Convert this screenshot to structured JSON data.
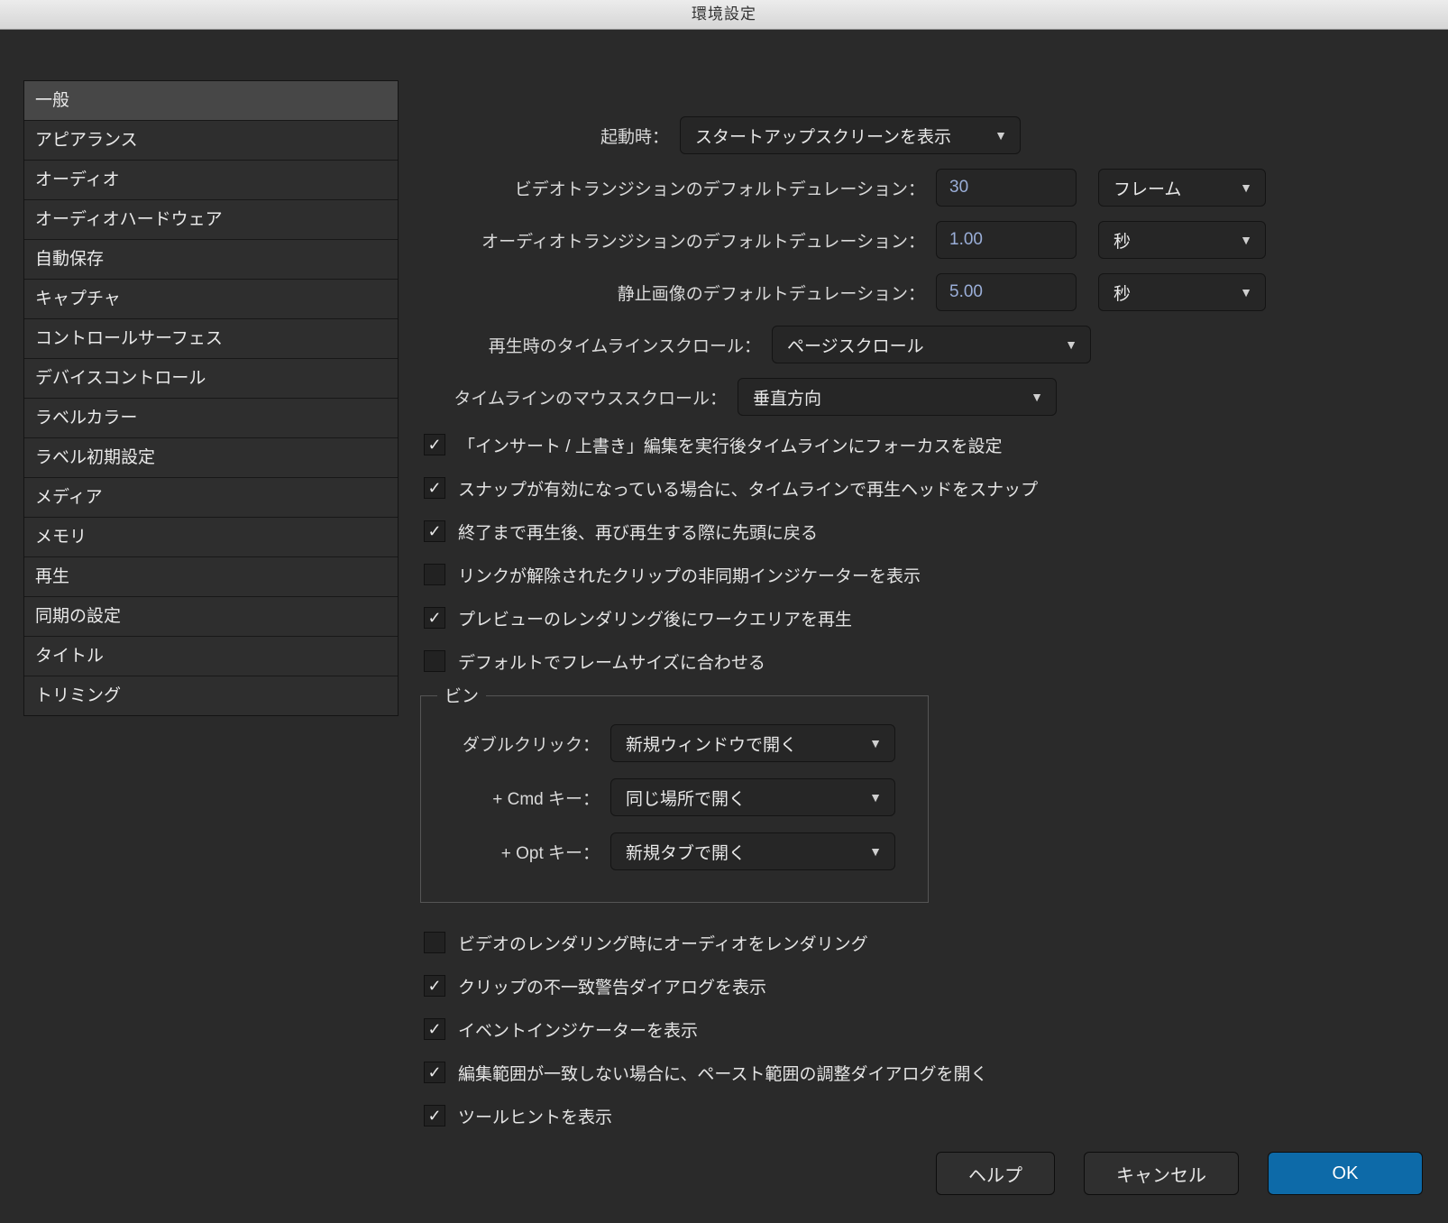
{
  "window_title": "環境設定",
  "sidebar": {
    "items": [
      "一般",
      "アピアランス",
      "オーディオ",
      "オーディオハードウェア",
      "自動保存",
      "キャプチャ",
      "コントロールサーフェス",
      "デバイスコントロール",
      "ラベルカラー",
      "ラベル初期設定",
      "メディア",
      "メモリ",
      "再生",
      "同期の設定",
      "タイトル",
      "トリミング"
    ],
    "selected_index": 0
  },
  "general": {
    "startup_label": "起動時：",
    "startup_value": "スタートアップスクリーンを表示",
    "video_trans_label": "ビデオトランジションのデフォルトデュレーション：",
    "video_trans_value": "30",
    "video_trans_unit": "フレーム",
    "audio_trans_label": "オーディオトランジションのデフォルトデュレーション：",
    "audio_trans_value": "1.00",
    "audio_trans_unit": "秒",
    "still_label": "静止画像のデフォルトデュレーション：",
    "still_value": "5.00",
    "still_unit": "秒",
    "playback_scroll_label": "再生時のタイムラインスクロール：",
    "playback_scroll_value": "ページスクロール",
    "mouse_scroll_label": "タイムラインのマウススクロール：",
    "mouse_scroll_value": "垂直方向",
    "cb1_label": "「インサート / 上書き」編集を実行後タイムラインにフォーカスを設定",
    "cb2_label": "スナップが有効になっている場合に、タイムラインで再生ヘッドをスナップ",
    "cb3_label": "終了まで再生後、再び再生する際に先頭に戻る",
    "cb4_label": "リンクが解除されたクリップの非同期インジケーターを表示",
    "cb5_label": "プレビューのレンダリング後にワークエリアを再生",
    "cb6_label": "デフォルトでフレームサイズに合わせる",
    "bin_legend": "ビン",
    "bin_dbl_label": "ダブルクリック：",
    "bin_dbl_value": "新規ウィンドウで開く",
    "bin_cmd_label": "+ Cmd キー：",
    "bin_cmd_value": "同じ場所で開く",
    "bin_opt_label": "+ Opt キー：",
    "bin_opt_value": "新規タブで開く",
    "cb7_label": "ビデオのレンダリング時にオーディオをレンダリング",
    "cb8_label": "クリップの不一致警告ダイアログを表示",
    "cb9_label": "イベントインジケーターを表示",
    "cb10_label": "編集範囲が一致しない場合に、ペースト範囲の調整ダイアログを開く",
    "cb11_label": "ツールヒントを表示"
  },
  "checkbox_states": {
    "cb1": true,
    "cb2": true,
    "cb3": true,
    "cb4": false,
    "cb5": true,
    "cb6": false,
    "cb7": false,
    "cb8": true,
    "cb9": true,
    "cb10": true,
    "cb11": true
  },
  "buttons": {
    "help": "ヘルプ",
    "cancel": "キャンセル",
    "ok": "OK"
  }
}
